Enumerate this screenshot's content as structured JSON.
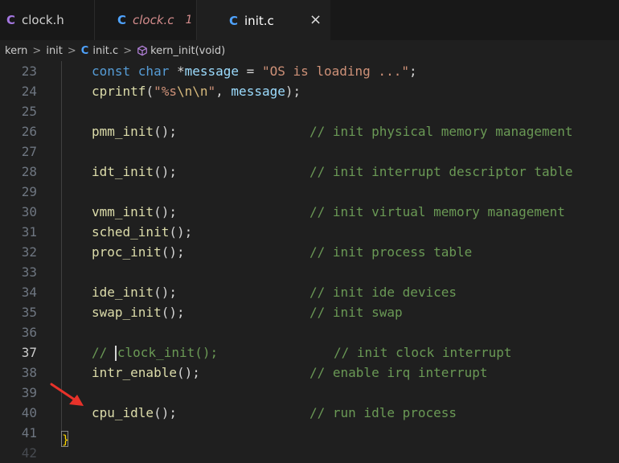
{
  "tabs": [
    {
      "lang": "C",
      "name": "clock.h"
    },
    {
      "lang": "C",
      "name": "clock.c",
      "badge": "1"
    },
    {
      "lang": "C",
      "name": "init.c",
      "close": "×"
    }
  ],
  "breadcrumb": {
    "items": [
      "kern",
      "init",
      "init.c",
      "kern_init(void)"
    ],
    "separator": ">",
    "lang": "C"
  },
  "editor": {
    "active_line": "37",
    "lines": [
      {
        "num": "23"
      },
      {
        "num": "24"
      },
      {
        "num": "25"
      },
      {
        "num": "26"
      },
      {
        "num": "27"
      },
      {
        "num": "28"
      },
      {
        "num": "29"
      },
      {
        "num": "30"
      },
      {
        "num": "31"
      },
      {
        "num": "32"
      },
      {
        "num": "33"
      },
      {
        "num": "34"
      },
      {
        "num": "35"
      },
      {
        "num": "36"
      },
      {
        "num": "37"
      },
      {
        "num": "38"
      },
      {
        "num": "39"
      },
      {
        "num": "40"
      },
      {
        "num": "41"
      },
      {
        "num": "42"
      }
    ],
    "code": {
      "l23_kw": "const char",
      "l23_star": " *",
      "l23_id": "message",
      "l23_eq": " = ",
      "l23_str": "\"OS is loading ...\"",
      "l23_end": ";",
      "l24_fn": "cprintf",
      "l24_open": "(",
      "l24_str1": "\"%s",
      "l24_esc": "\\n\\n",
      "l24_str2": "\"",
      "l24_comma": ", ",
      "l24_id": "message",
      "l24_close": ");",
      "l26_fn": "pmm_init",
      "l26_c": "// init physical memory management",
      "l28_fn": "idt_init",
      "l28_c": "// init interrupt descriptor table",
      "l30_fn": "vmm_init",
      "l30_c": "// init virtual memory management",
      "l31_fn": "sched_init",
      "l32_fn": "proc_init",
      "l32_c": "// init process table",
      "l34_fn": "ide_init",
      "l34_c": "// init ide devices",
      "l35_fn": "swap_init",
      "l35_c": "// init swap",
      "l37_pre": "// ",
      "l37_post": "clock_init();",
      "l37_c": "// init clock interrupt",
      "l38_fn": "intr_enable",
      "l38_c": "// enable irq interrupt",
      "l40_fn": "cpu_idle",
      "l40_c": "// run idle process",
      "call_suffix": "();",
      "brace": "}"
    }
  },
  "colors": {
    "keyword": "#569cd6",
    "variable": "#9cdcfe",
    "function": "#dcdcaa",
    "string": "#ce9178",
    "comment": "#6a9955",
    "arrow": "#e8322a"
  }
}
